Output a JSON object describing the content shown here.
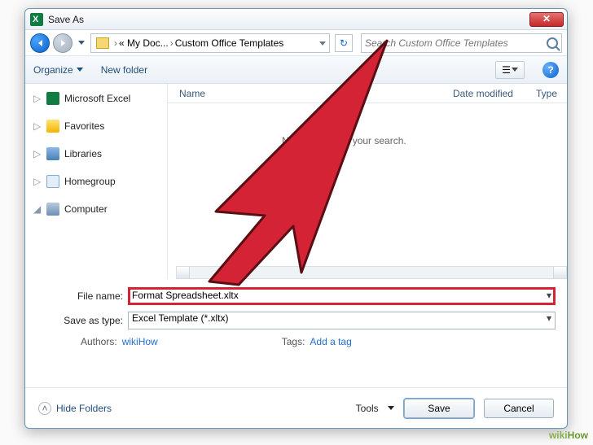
{
  "window": {
    "title": "Save As"
  },
  "nav": {
    "breadcrumb": {
      "seg1": "« My Doc...",
      "seg2": "Custom Office Templates"
    },
    "search_placeholder": "Search Custom Office Templates"
  },
  "toolbar": {
    "organize": "Organize",
    "new_folder": "New folder"
  },
  "sidebar": {
    "items": [
      {
        "label": "Microsoft Excel"
      },
      {
        "label": "Favorites"
      },
      {
        "label": "Libraries"
      },
      {
        "label": "Homegroup"
      },
      {
        "label": "Computer"
      }
    ]
  },
  "columns": {
    "name": "Name",
    "modified": "Date modified",
    "type": "Type"
  },
  "content": {
    "empty": "No items match your search."
  },
  "form": {
    "filename_label": "File name:",
    "filename_value": "Format Spreadsheet.xltx",
    "savetype_label": "Save as type:",
    "savetype_value": "Excel Template (*.xltx)",
    "authors_label": "Authors:",
    "authors_value": "wikiHow",
    "tags_label": "Tags:",
    "tags_value": "Add a tag"
  },
  "footer": {
    "hide_folders": "Hide Folders",
    "tools": "Tools",
    "save": "Save",
    "cancel": "Cancel"
  },
  "watermark": {
    "wiki": "wiki",
    "how": "How"
  }
}
